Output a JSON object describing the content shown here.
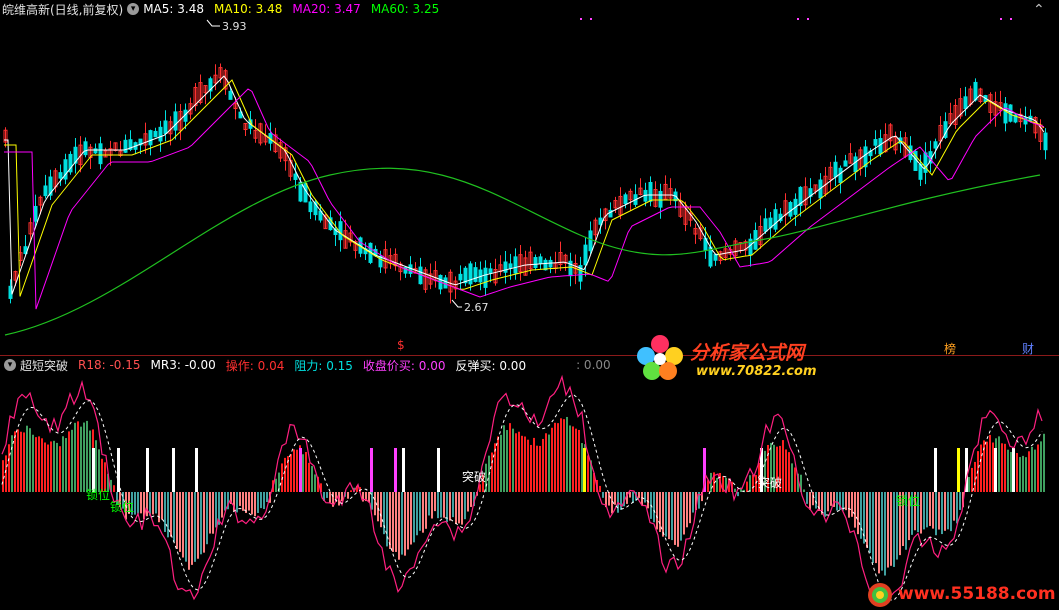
{
  "header": {
    "stock_title": "皖维高新(日线,前复权)",
    "ma": [
      {
        "label": "MA5: 3.48",
        "color": "#ffffff"
      },
      {
        "label": "MA10: 3.48",
        "color": "#ffff00"
      },
      {
        "label": "MA20: 3.47",
        "color": "#ff00ff"
      },
      {
        "label": "MA60: 3.25",
        "color": "#00ff00"
      }
    ]
  },
  "price_pane": {
    "high_label": "3.93",
    "low_label": "2.67",
    "candle_up_color": "#ff3030",
    "candle_down_color": "#00e0e0"
  },
  "markers": {
    "marker_1": "$",
    "marker_2": "榜",
    "marker_3": "财"
  },
  "indicator": {
    "name": "超短突破",
    "values": [
      {
        "label": "R18: -0.15",
        "color": "#ff5050"
      },
      {
        "label": "MR3: -0.00",
        "color": "#ffffff"
      },
      {
        "label": "操作: 0.04",
        "color": "#ff3030"
      },
      {
        "label": "阻力: 0.15",
        "color": "#00e0e0"
      },
      {
        "label": "收盘价买: 0.00",
        "color": "#ff40ff"
      },
      {
        "label": "反弹买: 0.00",
        "color": "#ffffff"
      },
      {
        "label": ": 0.00",
        "color": "#888888"
      }
    ],
    "signals": [
      {
        "text": "锁位",
        "color": "#00ff00"
      },
      {
        "text": "锁位",
        "color": "#00ff00"
      },
      {
        "text": "突破",
        "color": "#ffffff"
      },
      {
        "text": "突破",
        "color": "#ffffff"
      },
      {
        "text": "锁位",
        "color": "#00ff00"
      }
    ]
  },
  "watermarks": {
    "site_name": "分析家公式网",
    "site_url": "www.70822.com",
    "footer_url": "www.55188.com"
  }
}
